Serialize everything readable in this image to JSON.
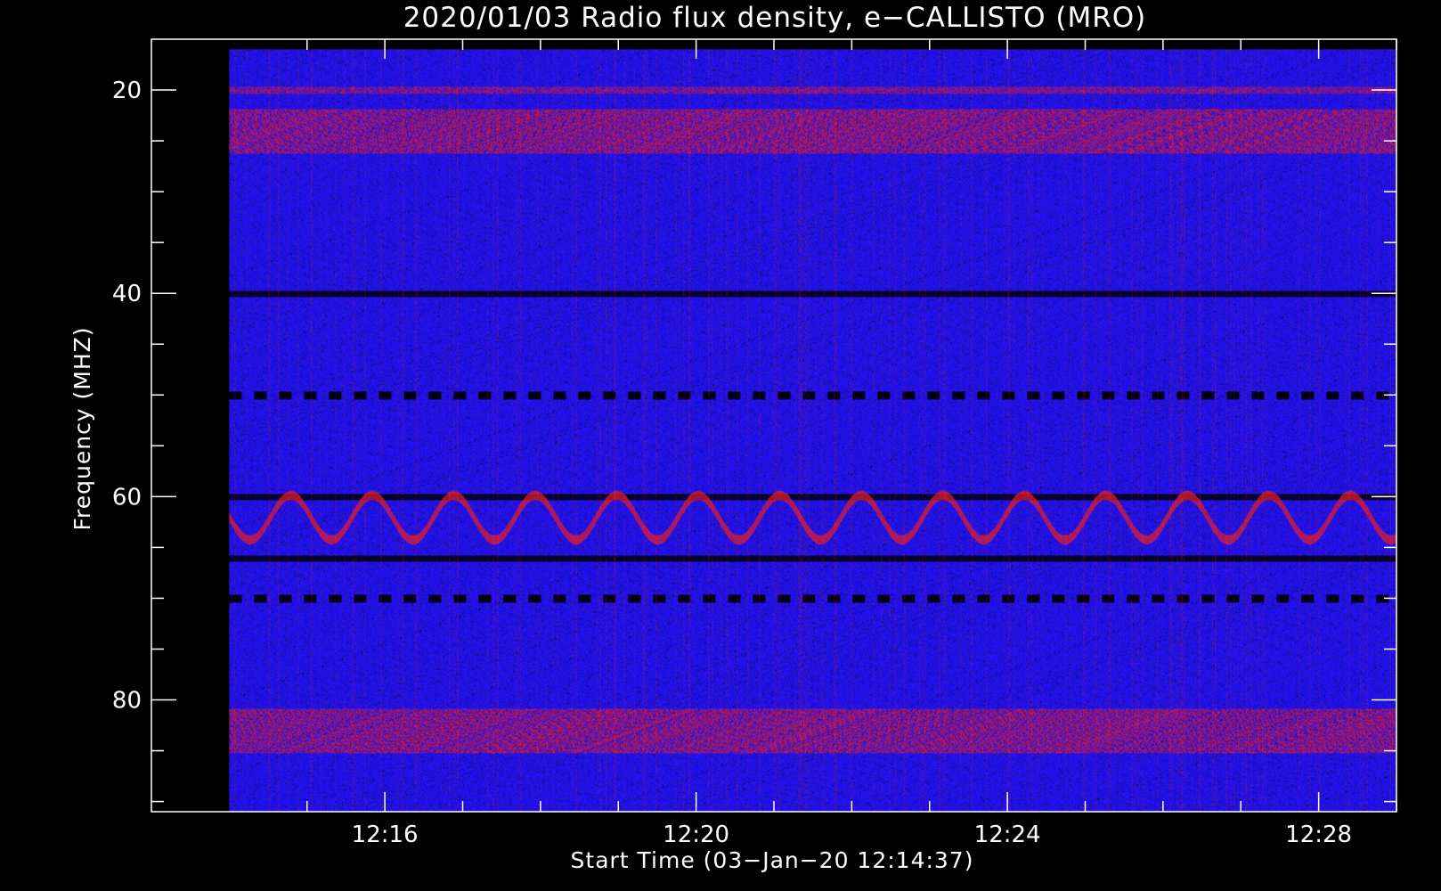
{
  "chart_data": {
    "type": "heatmap",
    "title": "2020/01/03  Radio flux density, e−CALLISTO (MRO)",
    "xlabel": "Start Time (03−Jan−20 12:14:37)",
    "ylabel": "Frequency (MHZ)",
    "x_unit": "minutes",
    "xlim": [
      "12:13",
      "12:29:30"
    ],
    "ylim": [
      91,
      15
    ],
    "data_xlim": [
      "12:14",
      "12:29"
    ],
    "data_ylim": [
      91,
      16
    ],
    "x_major_ticks": [
      "12:16",
      "12:20",
      "12:24",
      "12:28"
    ],
    "y_major_ticks": [
      20,
      40,
      60,
      80
    ],
    "y_minor_step": 5,
    "x_minor_step_minutes": 1,
    "colormap": {
      "low": "#1a10ff",
      "mid": "#5a0aa8",
      "high": "#ff2020",
      "dark": "#050535"
    },
    "horizontal_features": [
      {
        "freq_mhz": 20,
        "kind": "interference-line",
        "intensity": "high"
      },
      {
        "freq_mhz": 24,
        "kind": "narrowband-band",
        "intensity": "high"
      },
      {
        "freq_mhz": 40,
        "kind": "dark-line",
        "intensity": "low"
      },
      {
        "freq_mhz": 50,
        "kind": "dashed-dark-line",
        "intensity": "low"
      },
      {
        "freq_mhz": 60,
        "kind": "dark-line",
        "intensity": "low"
      },
      {
        "freq_mhz": 62,
        "kind": "wave-pattern",
        "intensity": "high"
      },
      {
        "freq_mhz": 66,
        "kind": "dark-line",
        "intensity": "low"
      },
      {
        "freq_mhz": 70,
        "kind": "dashed-dark-line",
        "intensity": "low"
      },
      {
        "freq_mhz": 83,
        "kind": "narrowband-band",
        "intensity": "high"
      }
    ],
    "grid": false,
    "legend": "none"
  }
}
